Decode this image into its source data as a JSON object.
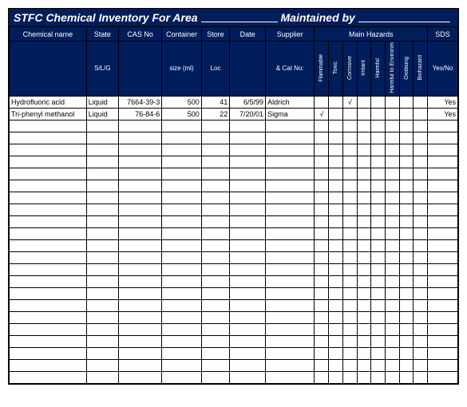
{
  "title": {
    "left": "STFC Chemical Inventory For Area",
    "right": "Maintained by"
  },
  "headers": {
    "row1": {
      "name": "Chemical name",
      "state": "State",
      "cas": "CAS No",
      "container": "Container",
      "store": "Store",
      "date": "Date",
      "supplier": "Supplier",
      "hazards": "Main Hazards",
      "sds": "SDS"
    },
    "row2": {
      "name": "",
      "state": "S/L/G",
      "cas": "",
      "container": "size (ml)",
      "store": "Loc",
      "date": "",
      "supplier": "& Cat No:",
      "haz": [
        "Flammable",
        "Toxic",
        "Corrosive",
        "Irritant",
        "Harmful",
        "Harmful to Environm",
        "Oxidising",
        "Biohazard"
      ],
      "sds": "Yes/No"
    }
  },
  "rows": [
    {
      "name": "Hydrofluoric acid",
      "state": "Liquid",
      "cas": "7664-39-3",
      "size": "500",
      "loc": "41",
      "date": "6/5/99",
      "supplier": "Aldrich",
      "haz": [
        "",
        "",
        "√",
        "",
        "",
        "",
        "",
        ""
      ],
      "sds": "Yes"
    },
    {
      "name": "Tri-phenyl methanol",
      "state": "Liquid",
      "cas": "76-84-6",
      "size": "500",
      "loc": "22",
      "date": "7/20/01",
      "supplier": "Sigma",
      "haz": [
        "√",
        "",
        "",
        "",
        "",
        "",
        "",
        ""
      ],
      "sds": "Yes"
    }
  ],
  "empty_rows": 22
}
